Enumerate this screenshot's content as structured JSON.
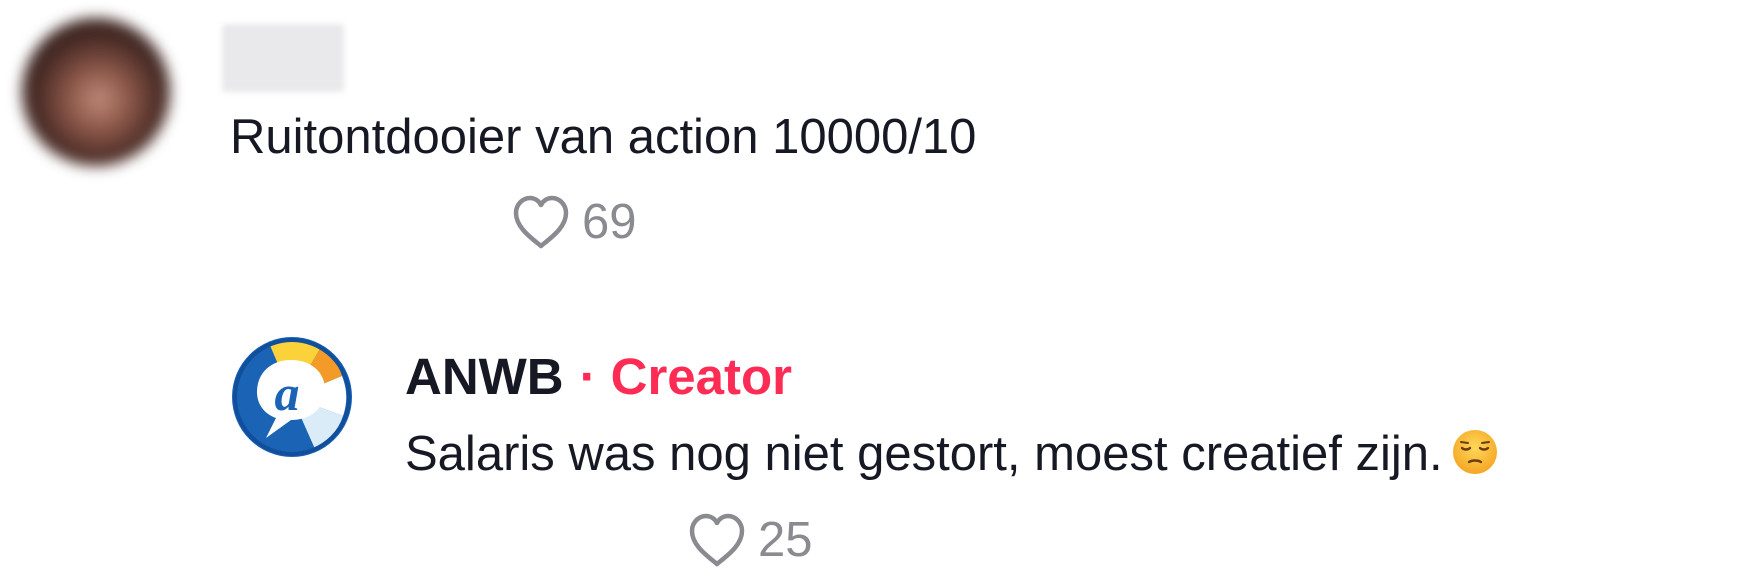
{
  "comment": {
    "text": "Ruitontdooier van action 10000/10",
    "likes": "69"
  },
  "reply": {
    "author": "ANWB",
    "separator": "·",
    "badge": "Creator",
    "text": "Salaris was nog niet gestort, moest creatief zijn.",
    "emoji": "pensive-face-icon",
    "likes": "25"
  },
  "colors": {
    "text": "#161823",
    "muted": "#8a8b91",
    "creator_badge": "#fe2c55"
  }
}
